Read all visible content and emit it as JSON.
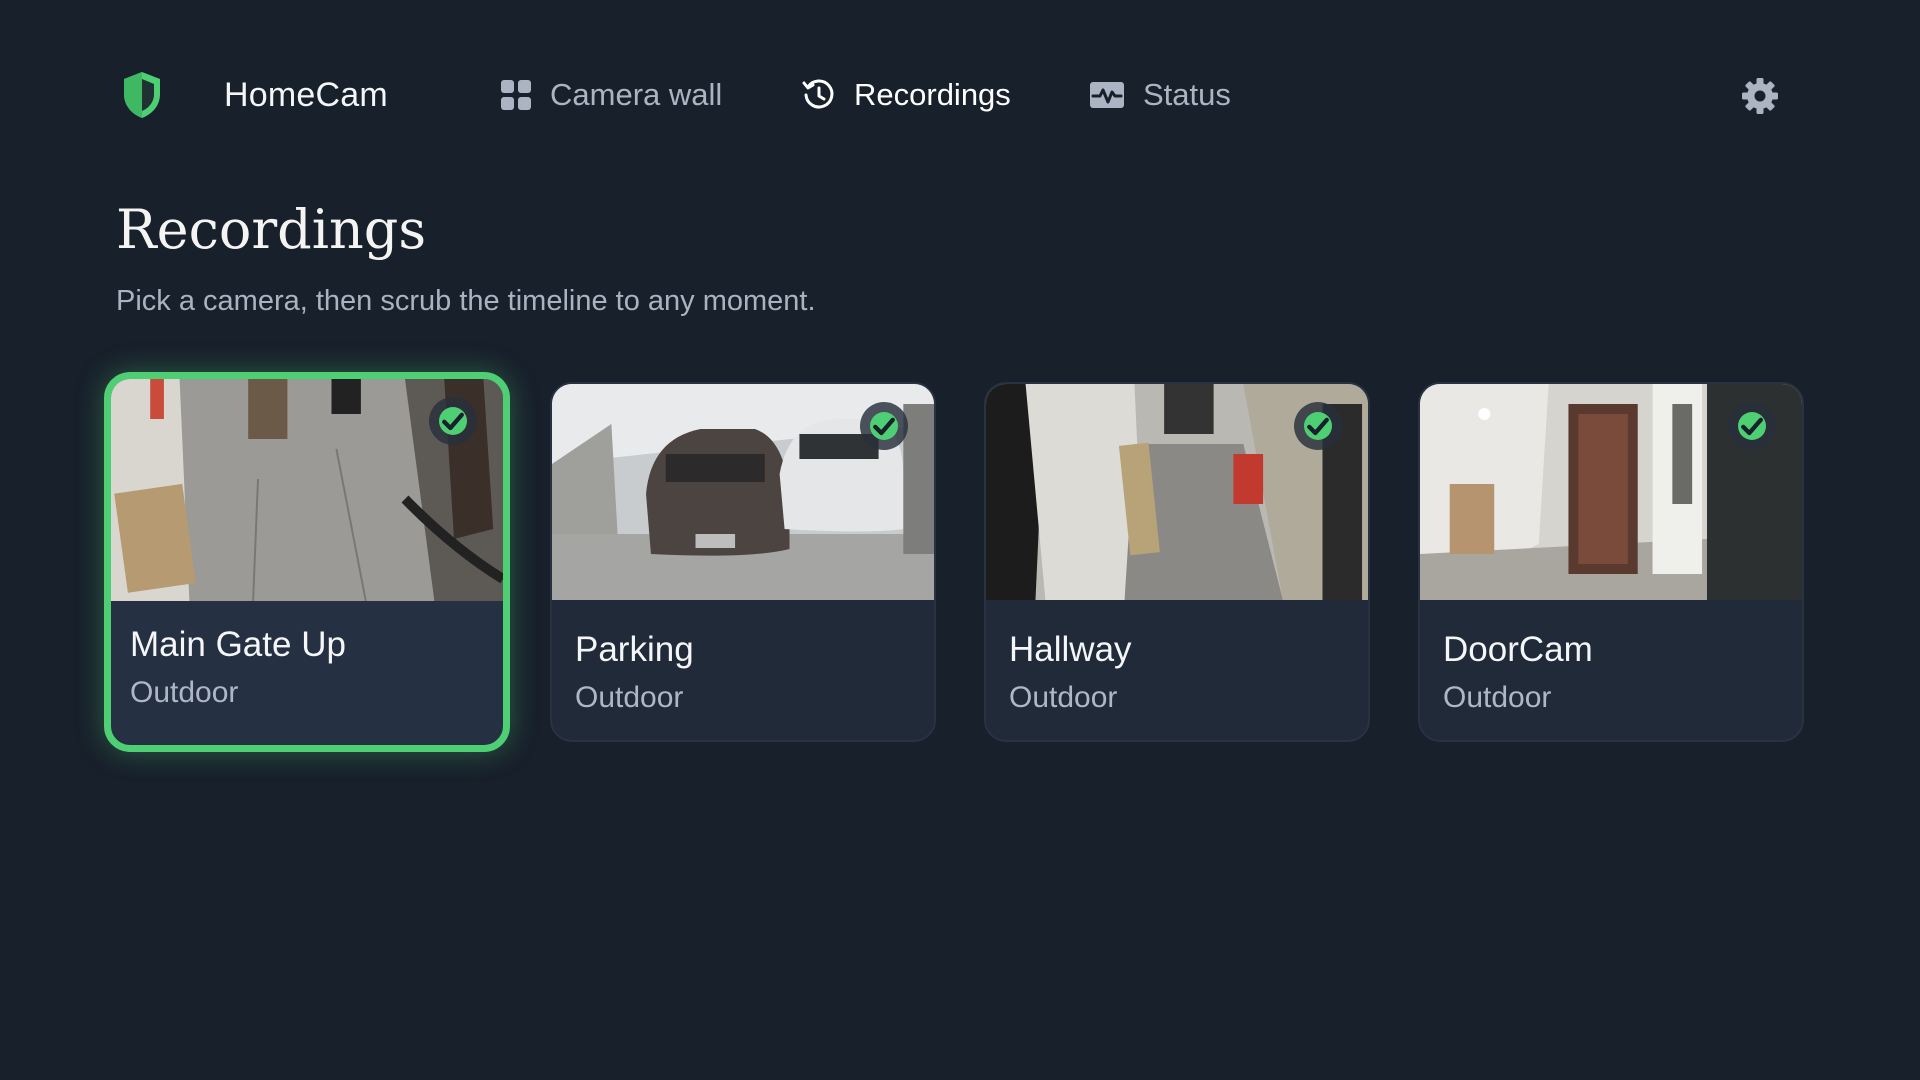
{
  "app": {
    "name": "HomeCam"
  },
  "nav": {
    "items": [
      {
        "label": "Camera wall",
        "icon": "grid-icon",
        "active": false
      },
      {
        "label": "Recordings",
        "icon": "history-icon",
        "active": true
      },
      {
        "label": "Status",
        "icon": "activity-icon",
        "active": false
      }
    ],
    "settings_icon": "gear-icon"
  },
  "page": {
    "title": "Recordings",
    "subtitle": "Pick a camera, then scrub the timeline to any moment."
  },
  "cameras": [
    {
      "name": "Main Gate Up",
      "type": "Outdoor",
      "selected": true,
      "status_icon": "check-circle-icon"
    },
    {
      "name": "Parking",
      "type": "Outdoor",
      "selected": false,
      "status_icon": "check-circle-icon"
    },
    {
      "name": "Hallway",
      "type": "Outdoor",
      "selected": false,
      "status_icon": "check-circle-icon"
    },
    {
      "name": "DoorCam",
      "type": "Outdoor",
      "selected": false,
      "status_icon": "check-circle-icon"
    }
  ],
  "colors": {
    "background": "#18202b",
    "card": "#212a39",
    "accent": "#4fcf74",
    "muted_text": "#aab4c2"
  }
}
